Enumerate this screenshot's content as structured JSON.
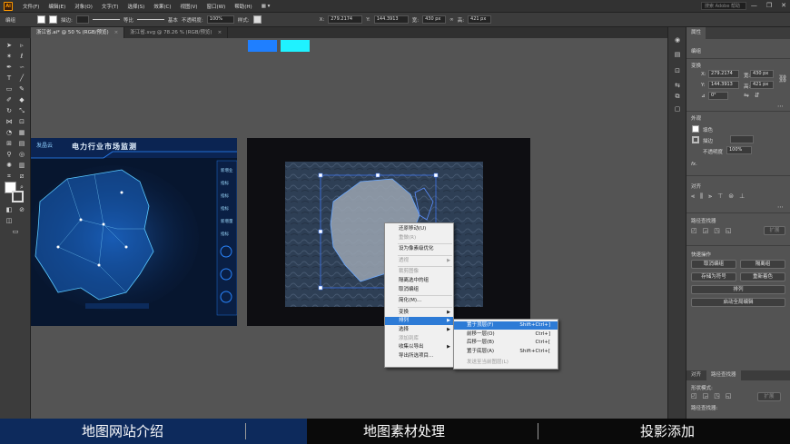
{
  "menubar": {
    "logo": "Ai",
    "items": [
      "文件(F)",
      "编辑(E)",
      "对象(O)",
      "文字(T)",
      "选择(S)",
      "效果(C)",
      "视图(V)",
      "窗口(W)",
      "帮助(H)"
    ],
    "search_placeholder": "搜索 Adobe 帮助",
    "win_controls": [
      "—",
      "❐",
      "✕"
    ]
  },
  "controlbar": {
    "selection_label": "编组",
    "stroke_label": "描边:",
    "uniform_label": "等比",
    "basic_label": "基本",
    "opacity_label": "不透明度:",
    "opacity_value": "100%",
    "style_label": "样式:",
    "x_label": "X:",
    "x_value": "279.2174",
    "y_label": "Y:",
    "y_value": "144.3913",
    "w_label": "宽:",
    "w_value": "430 px",
    "h_label": "高:",
    "h_value": "421 px"
  },
  "tabs": [
    {
      "label": "浙江省.ai* @ 50 % (RGB/预览)",
      "close": "×"
    },
    {
      "label": "浙江省.svg @ 78.26 % (RGB/预览)",
      "close": "×"
    }
  ],
  "left_board": {
    "brand": "发晶云",
    "title": "电力行业市场监测",
    "side_labels": [
      "新增业",
      "指标",
      "指标",
      "指标",
      "新增量",
      "指标"
    ]
  },
  "context_menu": {
    "items": [
      {
        "label": "还原移动(U)",
        "disabled": false,
        "arrow": false
      },
      {
        "label": "重做(R)",
        "disabled": true,
        "arrow": false
      },
      {
        "label": "设为像素级优化",
        "disabled": false,
        "arrow": false,
        "sep_before": true
      },
      {
        "label": "透视",
        "disabled": true,
        "arrow": true,
        "sep_before": true
      },
      {
        "label": "裁剪图像",
        "disabled": true,
        "arrow": false,
        "sep_before": true
      },
      {
        "label": "隔离选中的组",
        "disabled": false,
        "arrow": false
      },
      {
        "label": "取消编组",
        "disabled": false,
        "arrow": false
      },
      {
        "label": "简化(M)...",
        "disabled": false,
        "arrow": false,
        "sep_before": true
      },
      {
        "label": "变换",
        "disabled": false,
        "arrow": true,
        "sep_before": true
      },
      {
        "label": "排列",
        "disabled": false,
        "arrow": true,
        "highlighted": true
      },
      {
        "label": "选择",
        "disabled": false,
        "arrow": true
      },
      {
        "label": "添加到库",
        "disabled": true,
        "arrow": false
      },
      {
        "label": "收集以导出",
        "disabled": false,
        "arrow": true
      },
      {
        "label": "导出所选项目...",
        "disabled": false,
        "arrow": false
      }
    ]
  },
  "submenu": {
    "items": [
      {
        "label": "置于顶层(F)",
        "shortcut": "Shift+Ctrl+]",
        "highlighted": true
      },
      {
        "label": "前移一层(O)",
        "shortcut": "Ctrl+]"
      },
      {
        "label": "后移一层(B)",
        "shortcut": "Ctrl+["
      },
      {
        "label": "置于底层(A)",
        "shortcut": "Shift+Ctrl+["
      },
      {
        "label": "发送至当前图层(L)",
        "shortcut": "",
        "disabled": true
      }
    ]
  },
  "properties": {
    "tab_label": "属性",
    "section_group": "编组",
    "section_transform": "变换",
    "x_label": "X:",
    "x_value": "279.2174",
    "y_label": "Y:",
    "y_value": "144.3913",
    "w_label": "宽:",
    "w_value": "430 px",
    "h_label": "高:",
    "h_value": "421 px",
    "angle_label": "⊿",
    "angle_value": "0°",
    "section_appearance": "外观",
    "fill_label": "填色",
    "stroke_label": "描边",
    "opacity_label": "不透明度",
    "opacity_value": "100%",
    "fx_label": "fx.",
    "section_align": "对齐",
    "section_pathfinder": "路径查找器",
    "expand_label": "扩展",
    "section_quick": "快速操作",
    "btn_edit_content": "取消编组",
    "btn_isolate": "隔离组",
    "btn_save_symbol": "存储为符号",
    "btn_recolor": "重新着色",
    "btn_arrange": "排列",
    "btn_global_edit": "启动全局编辑",
    "bottom_tab_1": "对齐",
    "bottom_tab_2": "路径查找器",
    "shape_mode_label": "形状模式:",
    "pathfinder_label": "路径查找器:",
    "expand_label_2": "扩展"
  },
  "captions": [
    "地图网站介绍",
    "地图素材处理",
    "投影添加"
  ],
  "colors": {
    "accent_highlight": "#2d7bd6",
    "caption_active": "#0d2a5c",
    "chip_blue": "#1f7fff",
    "chip_cyan": "#1ff2ff"
  }
}
